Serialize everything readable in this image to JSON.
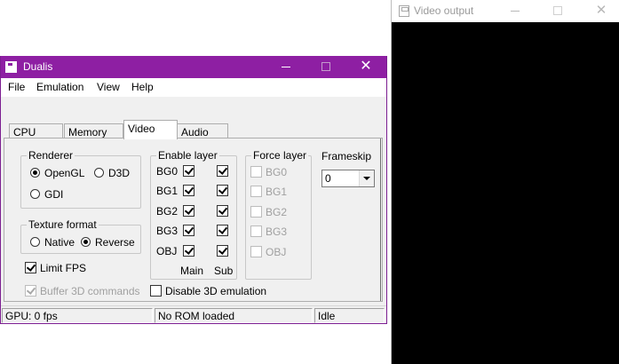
{
  "video_window": {
    "title": "Video output"
  },
  "dualis_window": {
    "title": "Dualis",
    "menu": [
      "File",
      "Emulation",
      "View",
      "Help"
    ],
    "tabs": [
      "CPU",
      "Memory",
      "Video",
      "Audio"
    ],
    "active_tab": "Video",
    "renderer": {
      "label": "Renderer",
      "options": [
        "OpenGL",
        "D3D",
        "GDI"
      ],
      "selected": "OpenGL"
    },
    "texture_format": {
      "label": "Texture format",
      "options": [
        "Native",
        "Reverse"
      ],
      "selected": "Reverse"
    },
    "limit_fps": {
      "label": "Limit FPS",
      "checked": true
    },
    "buffer_3d": {
      "label": "Buffer 3D commands",
      "checked": true,
      "disabled": true
    },
    "disable_3d": {
      "label": "Disable 3D emulation",
      "checked": false
    },
    "enable_layer": {
      "label": "Enable layer",
      "layers": [
        "BG0",
        "BG1",
        "BG2",
        "BG3",
        "OBJ"
      ],
      "main_label": "Main",
      "sub_label": "Sub"
    },
    "force_layer": {
      "label": "Force layer",
      "layers": [
        "BG0",
        "BG1",
        "BG2",
        "BG3",
        "OBJ"
      ]
    },
    "frameskip": {
      "label": "Frameskip",
      "value": "0"
    },
    "status": {
      "gpu": "GPU: 0 fps",
      "rom": "No ROM loaded",
      "state": "Idle"
    }
  }
}
